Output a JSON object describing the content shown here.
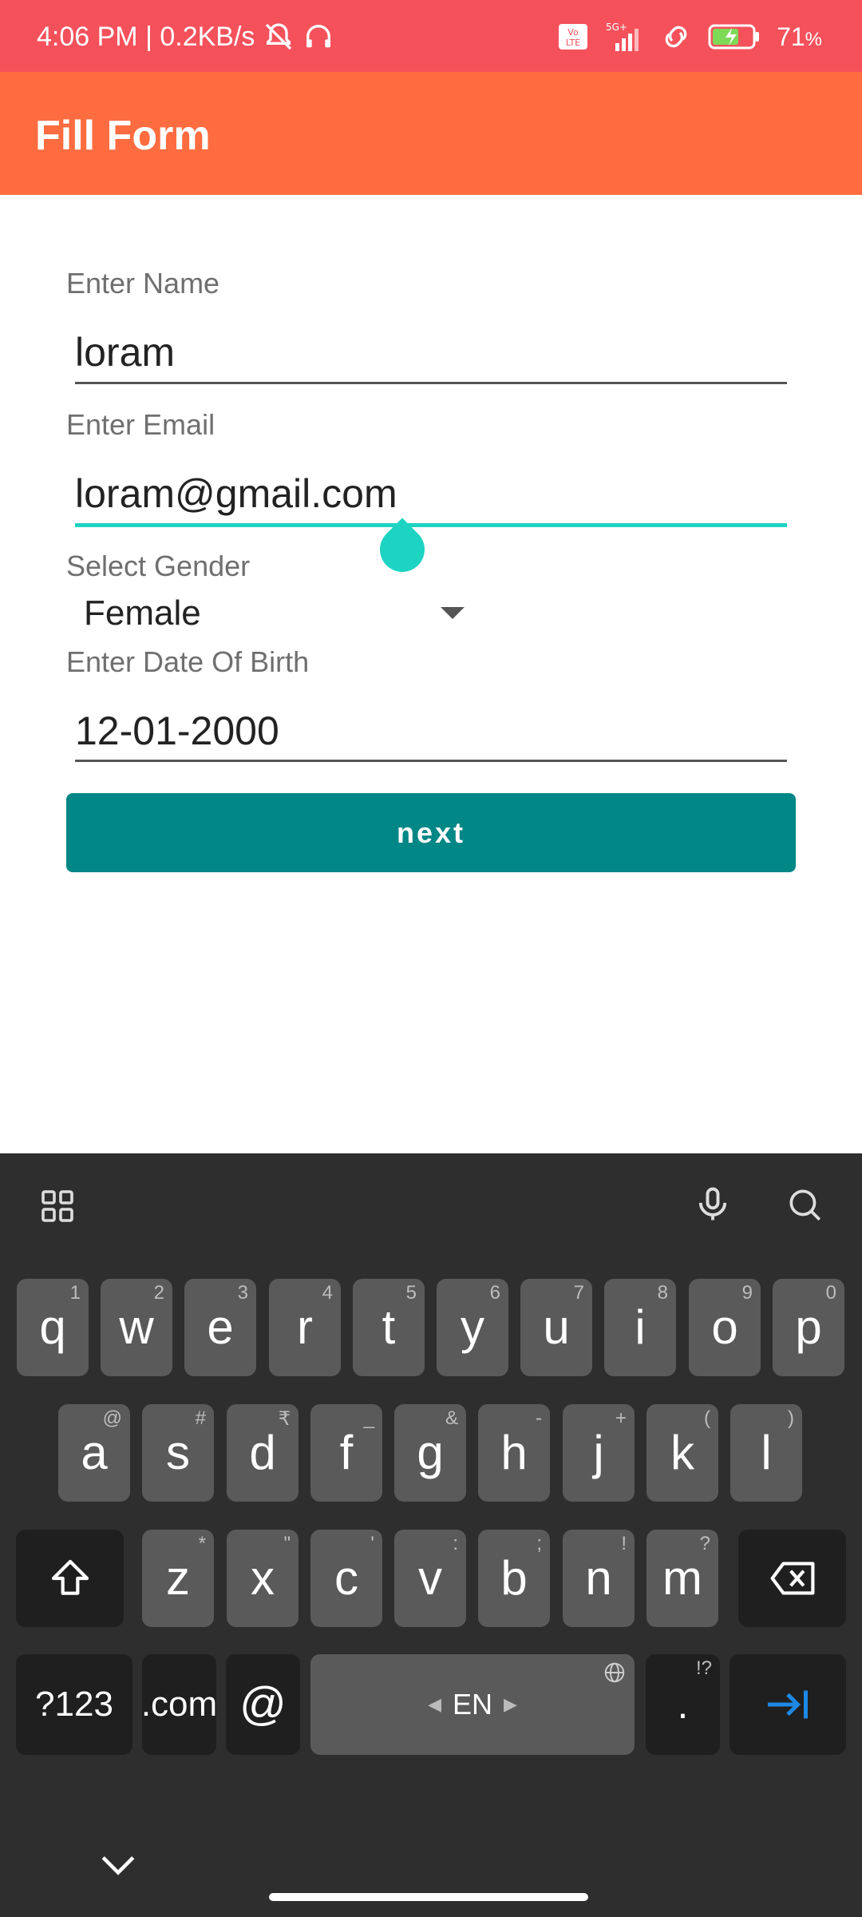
{
  "status_bar": {
    "time_net": "4:06 PM | 0.2KB/s",
    "battery": "71",
    "battery_unit": "%",
    "network": "5G+",
    "volte": "Vo LTE",
    "icons": [
      "bell-off-icon",
      "headphones-icon",
      "volte-icon",
      "signal-icon",
      "link-icon",
      "battery-icon"
    ]
  },
  "app_bar": {
    "title": "Fill Form"
  },
  "form": {
    "name_label": "Enter Name",
    "name_value": "loram",
    "email_label": "Enter Email",
    "email_value": "loram@gmail.com",
    "gender_label": "Select Gender",
    "gender_value": "Female",
    "dob_label": "Enter Date Of Birth",
    "dob_value": "12-01-2000",
    "next_label": "next"
  },
  "colors": {
    "status_bar": "#f5515b",
    "app_bar": "#ff6c40",
    "accent": "#1dd3c2",
    "button": "#018786",
    "keyboard_bg": "#2e2e2e",
    "key_bg": "#5a5a5a",
    "enter_icon": "#1e88e5"
  },
  "keyboard": {
    "row1": [
      {
        "label": "q",
        "hint": "1"
      },
      {
        "label": "w",
        "hint": "2"
      },
      {
        "label": "e",
        "hint": "3"
      },
      {
        "label": "r",
        "hint": "4"
      },
      {
        "label": "t",
        "hint": "5"
      },
      {
        "label": "y",
        "hint": "6"
      },
      {
        "label": "u",
        "hint": "7"
      },
      {
        "label": "i",
        "hint": "8"
      },
      {
        "label": "o",
        "hint": "9"
      },
      {
        "label": "p",
        "hint": "0"
      }
    ],
    "row2": [
      {
        "label": "a",
        "hint": "@"
      },
      {
        "label": "s",
        "hint": "#"
      },
      {
        "label": "d",
        "hint": "₹"
      },
      {
        "label": "f",
        "hint": "_"
      },
      {
        "label": "g",
        "hint": "&"
      },
      {
        "label": "h",
        "hint": "-"
      },
      {
        "label": "j",
        "hint": "+"
      },
      {
        "label": "k",
        "hint": "("
      },
      {
        "label": "l",
        "hint": ")"
      }
    ],
    "row3": [
      {
        "label": "z",
        "hint": "*"
      },
      {
        "label": "x",
        "hint": "\""
      },
      {
        "label": "c",
        "hint": "'"
      },
      {
        "label": "v",
        "hint": ":"
      },
      {
        "label": "b",
        "hint": ";"
      },
      {
        "label": "n",
        "hint": "!"
      },
      {
        "label": "m",
        "hint": "?"
      }
    ],
    "symbols_key": "?123",
    "com_key": ".com",
    "at_key": "@",
    "space_lang": "EN",
    "period_key": ".",
    "period_hint": "!?"
  }
}
